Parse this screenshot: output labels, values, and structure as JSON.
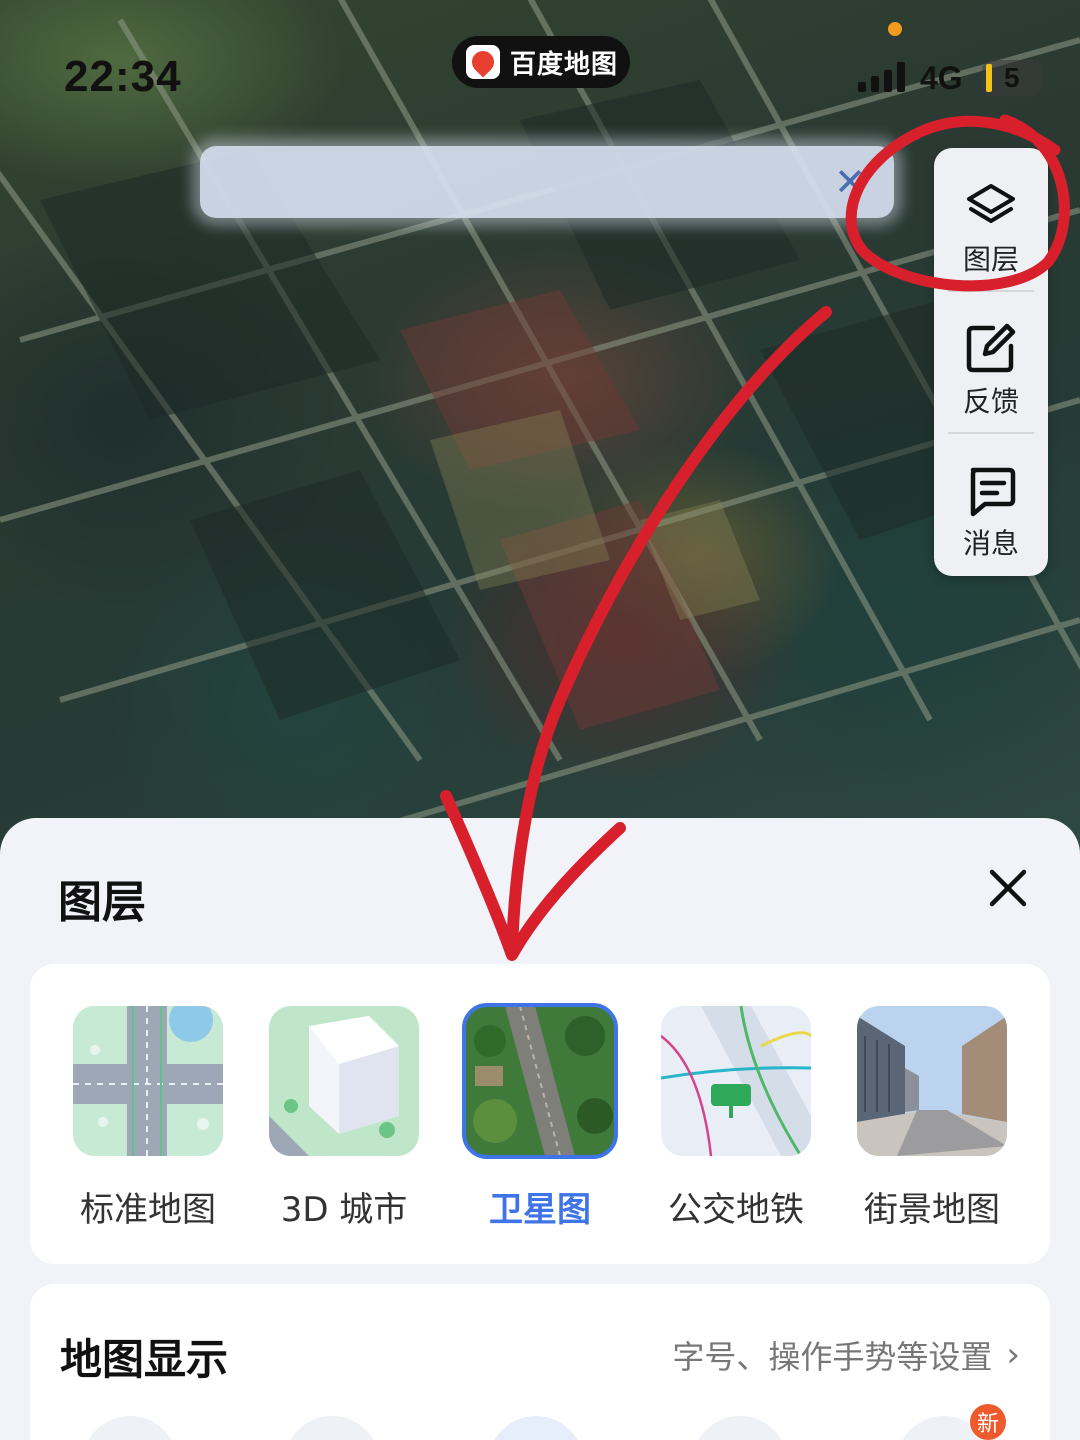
{
  "status_bar": {
    "time": "22:34",
    "network": "4G",
    "battery": "5"
  },
  "app_pill": {
    "name": "百度地图"
  },
  "search": {
    "clear_icon": "close-icon"
  },
  "tools": [
    {
      "label": "图层",
      "icon": "layers-icon"
    },
    {
      "label": "反馈",
      "icon": "feedback-edit-icon"
    },
    {
      "label": "消息",
      "icon": "message-icon"
    }
  ],
  "sheet": {
    "title": "图层",
    "layers": [
      {
        "label": "标准地图",
        "selected": false
      },
      {
        "label": "3D 城市",
        "selected": false
      },
      {
        "label": "卫星图",
        "selected": true
      },
      {
        "label": "公交地铁",
        "selected": false
      },
      {
        "label": "街景地图",
        "selected": false
      }
    ],
    "display": {
      "title": "地图显示",
      "link": "字号、操作手势等设置",
      "badge": "新"
    }
  },
  "colors": {
    "accent": "#3e74e8",
    "annotation": "#d8202c",
    "sheet_bg": "#f1f3f8"
  }
}
